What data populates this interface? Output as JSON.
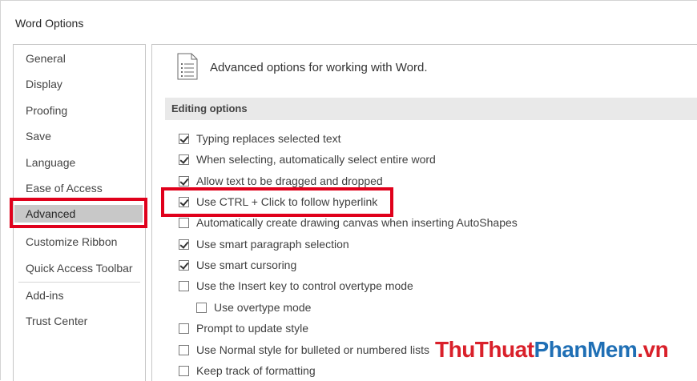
{
  "window": {
    "title": "Word Options"
  },
  "sidebar": {
    "items": [
      {
        "label": "General"
      },
      {
        "label": "Display"
      },
      {
        "label": "Proofing"
      },
      {
        "label": "Save"
      },
      {
        "label": "Language"
      },
      {
        "label": "Ease of Access"
      },
      {
        "label": "Advanced",
        "selected": true
      },
      {
        "label": "Customize Ribbon"
      },
      {
        "label": "Quick Access Toolbar"
      },
      {
        "label": "Add-ins"
      },
      {
        "label": "Trust Center"
      }
    ]
  },
  "main": {
    "header": "Advanced options for working with Word.",
    "section_title": "Editing options",
    "options": [
      {
        "label": "Typing replaces selected text",
        "checked": true
      },
      {
        "label": "When selecting, automatically select entire word",
        "checked": true
      },
      {
        "label": "Allow text to be dragged and dropped",
        "checked": true
      },
      {
        "label": "Use CTRL + Click to follow hyperlink",
        "checked": true
      },
      {
        "label": "Automatically create drawing canvas when inserting AutoShapes",
        "checked": false
      },
      {
        "label": "Use smart paragraph selection",
        "checked": true
      },
      {
        "label": "Use smart cursoring",
        "checked": true
      },
      {
        "label": "Use the Insert key to control overtype mode",
        "checked": false
      },
      {
        "label": "Use overtype mode",
        "checked": false
      },
      {
        "label": "Prompt to update style",
        "checked": false
      },
      {
        "label": "Use Normal style for bulleted or numbered lists",
        "checked": false
      },
      {
        "label": "Keep track of formatting",
        "checked": false
      }
    ]
  },
  "watermark": {
    "part1": "ThuThuat",
    "part2": "PhanMem",
    "part3": ".vn"
  },
  "colors": {
    "highlight": "#e0001b",
    "selected_bg": "#c8c8c8",
    "section_bg": "#e9e9e9"
  }
}
